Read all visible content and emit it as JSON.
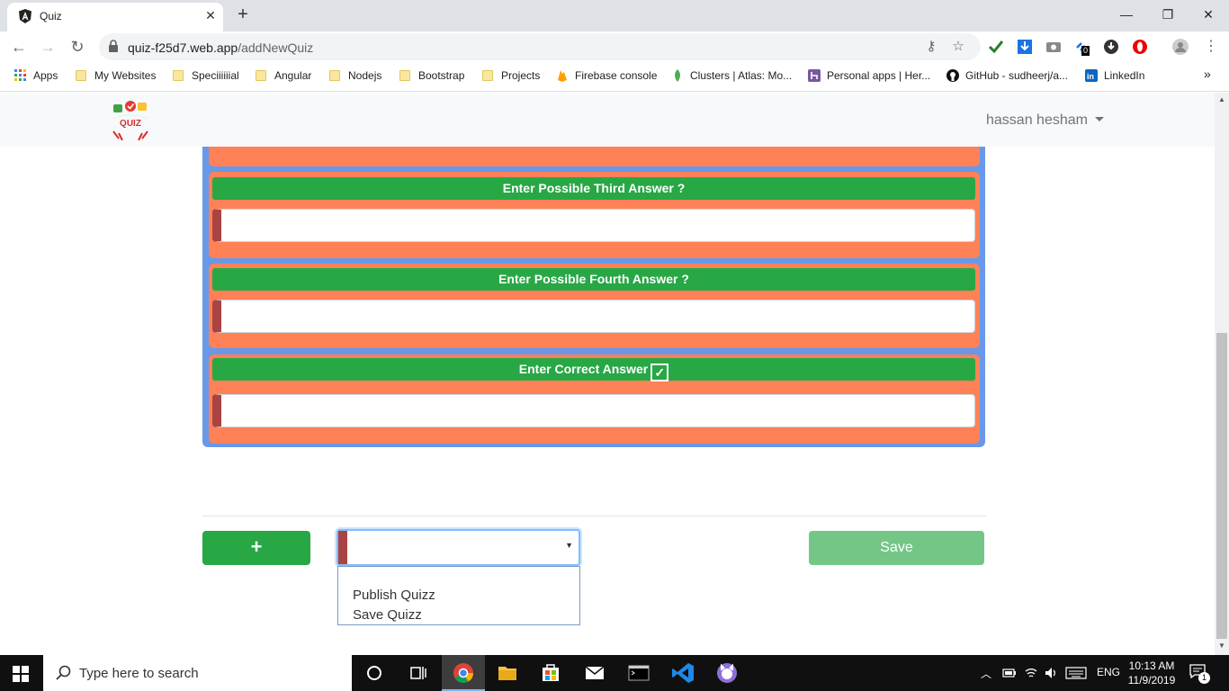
{
  "browser": {
    "tab_title": "Quiz",
    "url_host": "quiz-f25d7.web.app",
    "url_path": "/addNewQuiz",
    "ext_badge": "0"
  },
  "bookmarks": [
    {
      "label": "Apps",
      "icon": "apps-grid-icon"
    },
    {
      "label": "My Websites",
      "icon": "folder-icon"
    },
    {
      "label": "Speciiiiiial",
      "icon": "folder-icon"
    },
    {
      "label": "Angular",
      "icon": "folder-icon"
    },
    {
      "label": "Nodejs",
      "icon": "folder-icon"
    },
    {
      "label": "Bootstrap",
      "icon": "folder-icon"
    },
    {
      "label": "Projects",
      "icon": "folder-icon"
    },
    {
      "label": "Firebase console",
      "icon": "firebase-icon"
    },
    {
      "label": "Clusters | Atlas: Mo...",
      "icon": "mongodb-leaf-icon"
    },
    {
      "label": "Personal apps | Her...",
      "icon": "heroku-icon"
    },
    {
      "label": "GitHub - sudheerj/a...",
      "icon": "github-icon"
    },
    {
      "label": "LinkedIn",
      "icon": "linkedin-icon"
    }
  ],
  "bookmarks_overflow": "»",
  "navbar": {
    "logo_text": "QUIZ",
    "user_name": "hassan hesham"
  },
  "quiz_form": {
    "third_answer_label": "Enter Possible Third Answer ?",
    "fourth_answer_label": "Enter Possible Fourth Answer ?",
    "correct_answer_label": "Enter Correct Answer",
    "third_answer_value": "",
    "fourth_answer_value": "",
    "correct_answer_value": ""
  },
  "actions": {
    "add_label": "+",
    "save_label": "Save",
    "select_value": "",
    "options": [
      "Publish Quizz",
      "Save Quizz"
    ]
  },
  "taskbar": {
    "search_placeholder": "Type here to search",
    "language": "ENG",
    "time": "10:13 AM",
    "date": "11/9/2019",
    "notification_count": "1"
  },
  "colors": {
    "card_blue": "#6a98e8",
    "block_orange": "#ff8157",
    "header_green": "#28a745",
    "input_accent": "#a94442",
    "save_disabled": "#74c687"
  }
}
